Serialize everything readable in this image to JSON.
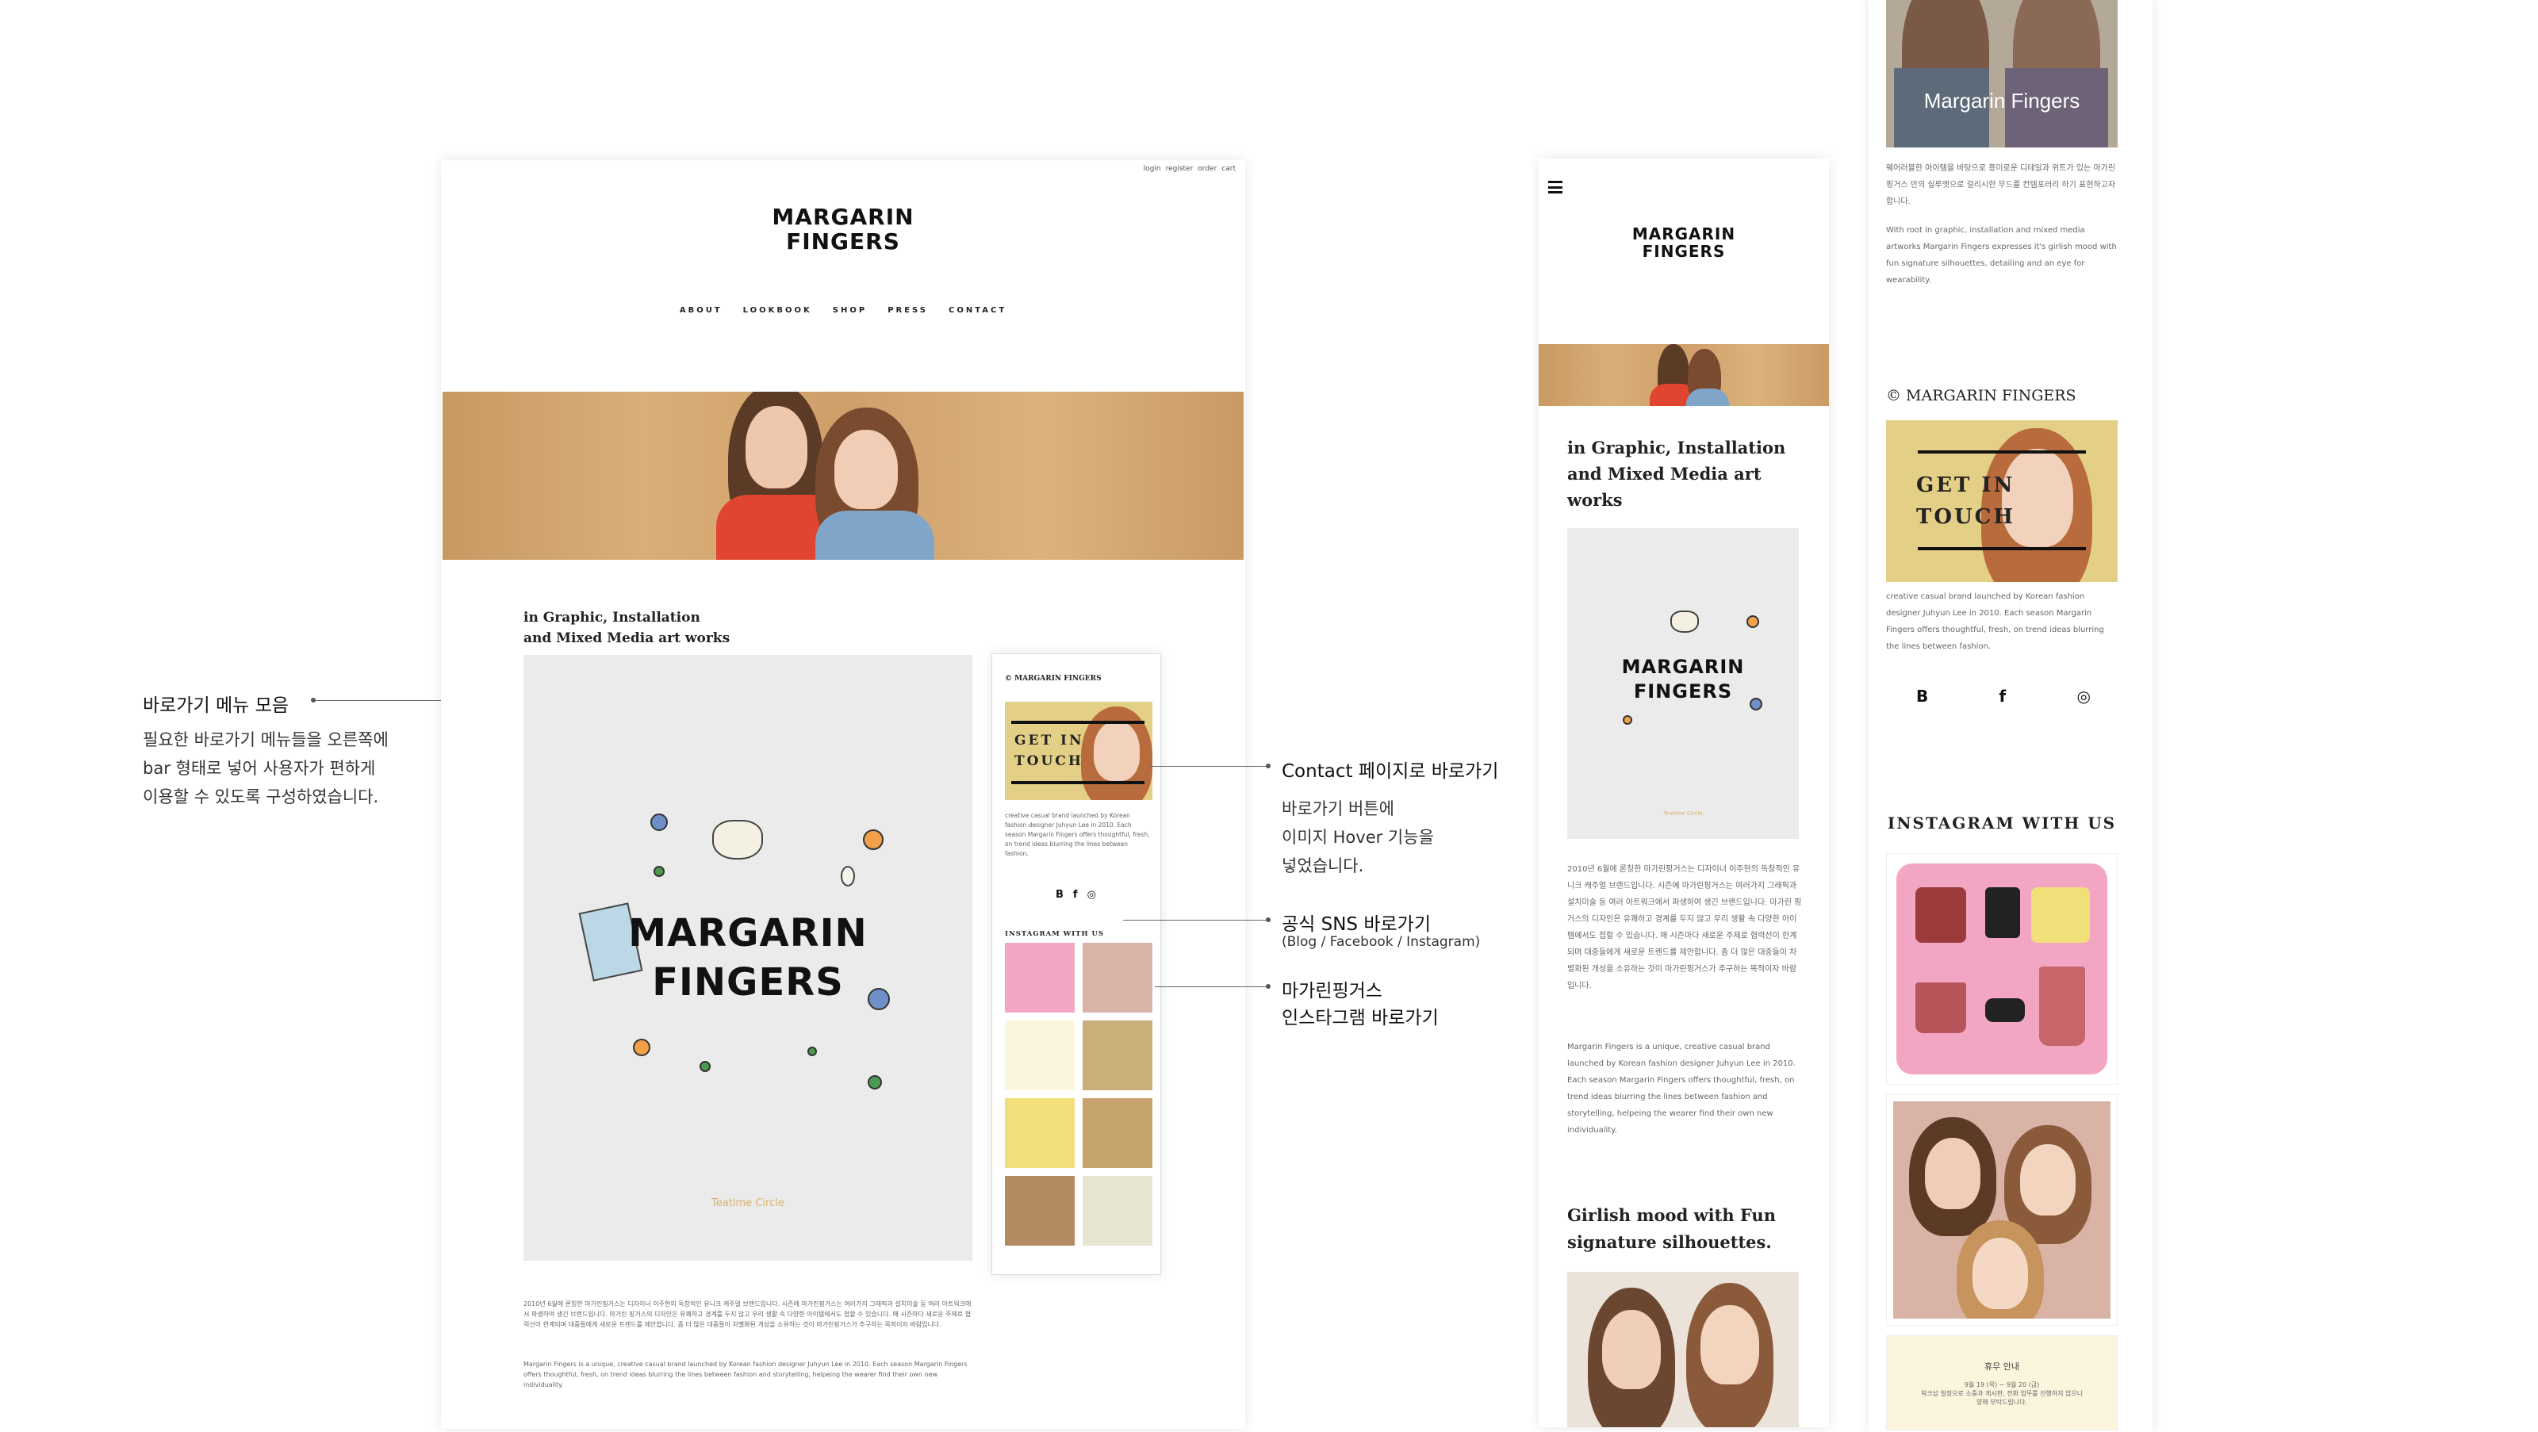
{
  "site": {
    "logo_line1": "MARGARIN",
    "logo_line2": "FINGERS",
    "top_links": [
      "login",
      "register",
      "order",
      "cart"
    ],
    "nav": [
      "ABOUT",
      "LOOKBOOK",
      "SHOP",
      "PRESS",
      "CONTACT"
    ],
    "intro_title_line1": "in Graphic, Installation",
    "intro_title_line2": "and Mixed Media art works",
    "mobile_intro_line1": "in Graphic, Installation",
    "mobile_intro_line2": "and Mixed Media art",
    "mobile_intro_line3": "works",
    "teatime": "Teatime Circle",
    "body_ko": "2010년 6월에 론칭한 마가린핑거스는 디자이너 이주현의 독창적인 유니크 캐주얼 브랜드입니다. 시즌에 마가린핑거스는 여러가지 그래픽과 설치미술 등 여러 아트워크에서 파생하여 생긴 브랜드입니다. 마가린 핑거스의 디자인은 유쾌하고 경계를 두지 않고 우리 생활 속 다양한 아이템에서도 접할 수 있습니다. 매 시즌마다 새로운 주제로 협력선이 한계되며 대중들에게 새로운 트렌드를 제안합니다. 좀 더 많은 대중들이 차별화된 개성을 소유하는 것이 마가린핑거스가 추구하는 목적이자 바람입니다.",
    "body_en": "Margarin Fingers is a unique, creative casual brand launched by Korean fashion designer Juhyun Lee in 2010. Each season Margarin Fingers offers thoughtful, fresh, on trend ideas blurring the lines between fashion and storytelling, helpeing the wearer find their own new individuality.",
    "girlish_line1": "Girlish mood with Fun",
    "girlish_line2": "signature silhouettes.",
    "right_photo_caption": "Margarin Fingers",
    "right_ko": "웨어러블한 아이템을 바탕으로 흥미로운 디테일과 위트가 있는 마가린핑거스 만의 실루엣으로 걸리시한 무드를 컨템포러리 하기 표현하고자 합니다.",
    "right_en": "With root in graphic, installation and mixed media artworks Margarin Fingers expresses it's girlish mood with fun signature silhouettes, detailing and an eye for wearability."
  },
  "sidebar": {
    "copyright": "© MARGARIN FINGERS",
    "get_in_touch_line1": "GET IN",
    "get_in_touch_line2": "TOUCH",
    "desc": "creative casual brand launched by Korean fashion designer Juhyun Lee in 2010. Each season Margarin Fingers offers thoughtful, fresh, on trend ideas blurring the lines between fashion.",
    "sns": [
      "B",
      "f",
      "◎"
    ],
    "instagram_title": "INSTAGRAM WITH US",
    "notice_title": "휴무 안내",
    "notice_l1": "9월 19 (목) ~ 9월 20 (금)",
    "notice_l2": "워크샵 일정으로 소중과 게시판, 전화 업무를 진행하지 않으니",
    "notice_l3": "양해 부탁드립니다."
  },
  "callouts": {
    "menu_title": "바로가기 메뉴 모음",
    "menu_l1": "필요한 바로가기 메뉴들을 오른쪽에",
    "menu_l2": "bar 형태로 넣어 사용자가 편하게",
    "menu_l3": "이용할 수 있도록 구성하였습니다.",
    "contact_title": "Contact 페이지로 바로가기",
    "contact_l1": "바로가기 버튼에",
    "contact_l2": "이미지 Hover 기능을",
    "contact_l3": "넣었습니다.",
    "sns_title": "공식 SNS 바로가기",
    "sns_sub": "(Blog / Facebook / Instagram)",
    "insta_l1": "마가린핑거스",
    "insta_l2": "인스타그램 바로가기"
  },
  "colors": {
    "wood": "#d3a66f",
    "get_in_touch_bg": "#e4cf86",
    "pink": "#f3a6c4",
    "red": "#e0452f",
    "blue": "#7fa6c9"
  }
}
